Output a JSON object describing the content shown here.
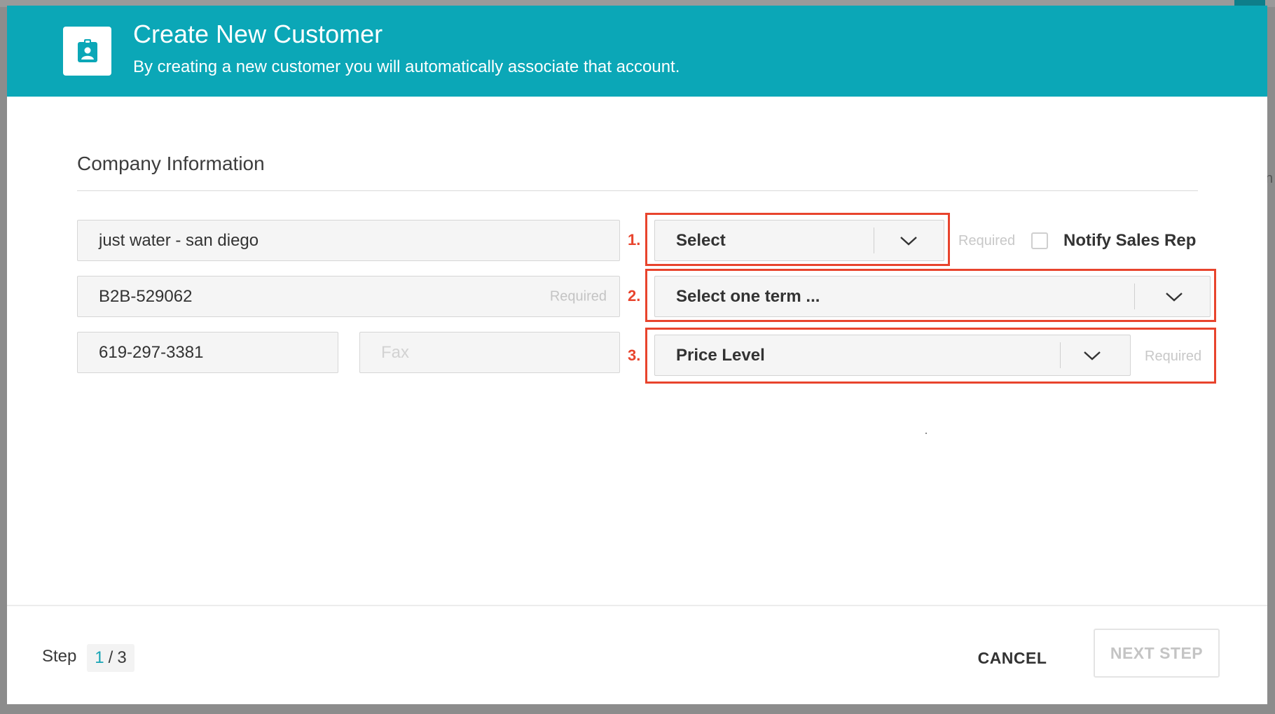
{
  "dialog": {
    "title": "Create New Customer",
    "subtitle": "By creating a new customer you will automatically associate that account.",
    "header_color": "#0ba7b7",
    "header_icon": "contact-card-icon"
  },
  "section": {
    "title": "Company Information"
  },
  "fields": {
    "company_name": {
      "value": "just water - san diego"
    },
    "account_number": {
      "value": "B2B-529062",
      "hint": "Required"
    },
    "phone": {
      "value": "619-297-3381"
    },
    "fax": {
      "placeholder": "Fax"
    }
  },
  "selects": {
    "first": {
      "value": "Select",
      "required_label": "Required"
    },
    "terms": {
      "value": "Select one term ..."
    },
    "price_level": {
      "value": "Price Level",
      "required_label": "Required"
    }
  },
  "annotations": {
    "one": "1.",
    "two": "2.",
    "three": "3.",
    "color": "#e8442d"
  },
  "notify": {
    "label": "Notify Sales Rep",
    "checked": false
  },
  "footer": {
    "step_label": "Step",
    "step_current": "1",
    "step_separator": "/",
    "step_total": "3",
    "cancel_label": "CANCEL",
    "next_label": "NEXT STEP"
  }
}
